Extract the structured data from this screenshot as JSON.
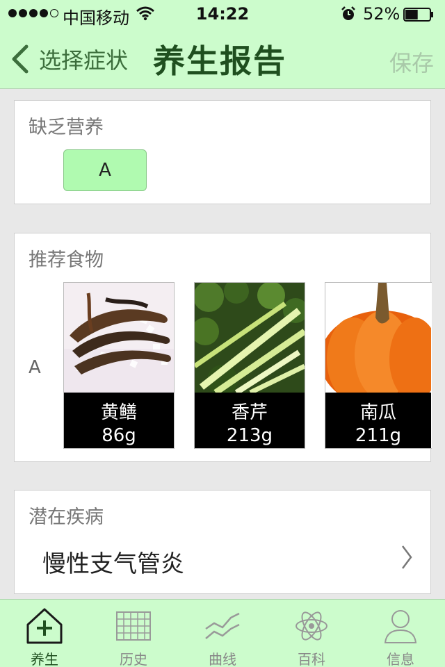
{
  "status_bar": {
    "carrier": "中国移动",
    "time": "14:22",
    "battery_percent": "52%",
    "signal_bars": 4,
    "signal_total": 5,
    "battery_level": 0.52
  },
  "nav": {
    "back_label": "选择症状",
    "title": "养生报告",
    "save_label": "保存"
  },
  "nutrition": {
    "title": "缺乏营养",
    "tags": [
      "A"
    ]
  },
  "foods": {
    "title": "推荐食物",
    "row_label": "A",
    "items": [
      {
        "name": "黄鳝",
        "quantity": "86g",
        "image": "eel-photo"
      },
      {
        "name": "香芹",
        "quantity": "213g",
        "image": "celery-photo"
      },
      {
        "name": "南瓜",
        "quantity": "211g",
        "image": "pumpkin-photo"
      }
    ]
  },
  "disease": {
    "title": "潜在疾病",
    "items": [
      "慢性支气管炎"
    ]
  },
  "tabs": [
    {
      "label": "养生",
      "icon": "home-plus-icon",
      "active": true
    },
    {
      "label": "历史",
      "icon": "grid-icon",
      "active": false
    },
    {
      "label": "曲线",
      "icon": "line-chart-icon",
      "active": false
    },
    {
      "label": "百科",
      "icon": "atom-icon",
      "active": false
    },
    {
      "label": "信息",
      "icon": "user-icon",
      "active": false
    }
  ],
  "colors": {
    "header_bg": "#ccfccc",
    "title_green": "#1f4f1f",
    "tag_bg": "#b0fab0"
  }
}
